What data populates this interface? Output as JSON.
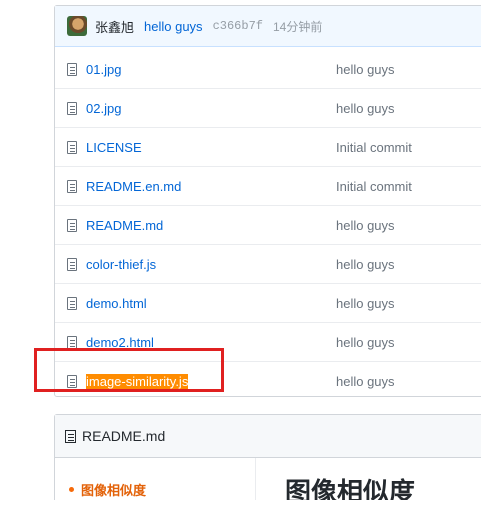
{
  "commit": {
    "author": "张鑫旭",
    "message": "hello guys",
    "sha": "c366b7f",
    "time": "14分钟前"
  },
  "files": [
    {
      "name": "01.jpg",
      "message": "hello guys"
    },
    {
      "name": "02.jpg",
      "message": "hello guys"
    },
    {
      "name": "LICENSE",
      "message": "Initial commit"
    },
    {
      "name": "README.en.md",
      "message": "Initial commit"
    },
    {
      "name": "README.md",
      "message": "hello guys"
    },
    {
      "name": "color-thief.js",
      "message": "hello guys"
    },
    {
      "name": "demo.html",
      "message": "hello guys"
    },
    {
      "name": "demo2.html",
      "message": "hello guys"
    },
    {
      "name": "image-similarity.js",
      "message": "hello guys",
      "highlighted": true
    }
  ],
  "readme": {
    "header": "README.md",
    "toc_item": "图像相似度",
    "title": "图像相似度"
  },
  "colors": {
    "link": "#0366d6",
    "highlight": "#ff8c00",
    "annotation_border": "#e02020",
    "toc_accent": "#e36209"
  }
}
